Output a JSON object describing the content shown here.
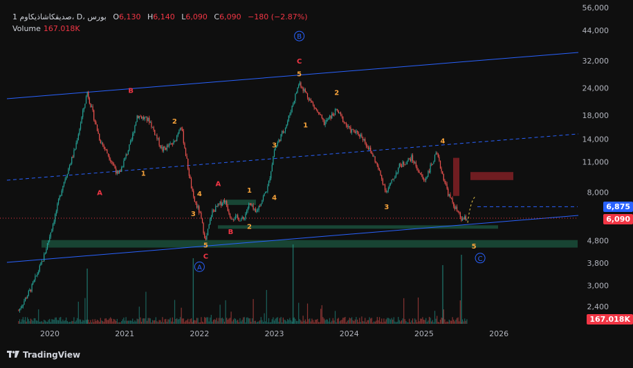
{
  "legend": {
    "symbol": "1 صديقكاشاذيكاوم، D، بورس",
    "open_label": "O",
    "open": "6,130",
    "high_label": "H",
    "high": "6,140",
    "low_label": "L",
    "low": "6,090",
    "close_label": "C",
    "close": "6,090",
    "change": "−180 (−2.87%)",
    "volume_label": "Volume",
    "volume": "167.018K"
  },
  "badges": {
    "line_price": "6,875",
    "last_price": "6,090",
    "volume": "167.018K"
  },
  "brand": "TradingView",
  "colors": {
    "background": "#0f0f0f",
    "up": "#26a69a",
    "down": "#ef5350",
    "trendline": "#2962ff",
    "wave_label": "#f7a33b",
    "abc_label": "#f23645",
    "zone_green": "#1a4d3a",
    "zone_red": "#7a1f24"
  },
  "chart_data": {
    "type": "candlestick",
    "y_scale": "log",
    "y_ticks": [
      "56,000",
      "44,000",
      "32,000",
      "24,000",
      "18,000",
      "14,000",
      "11,000",
      "8,000",
      "6,875",
      "6,090",
      "4,800",
      "3,800",
      "3,000",
      "2,400"
    ],
    "x_ticks": [
      "2020",
      "2021",
      "2022",
      "2023",
      "2024",
      "2025",
      "2026"
    ],
    "price_path": [
      [
        "2019-08",
        2300
      ],
      [
        "2019-10",
        2900
      ],
      [
        "2019-12",
        4000
      ],
      [
        "2020-02",
        6500
      ],
      [
        "2020-03",
        8500
      ],
      [
        "2020-05",
        12500
      ],
      [
        "2020-07",
        23000
      ],
      [
        "2020-09",
        14000
      ],
      [
        "2020-11",
        11000
      ],
      [
        "2020-12",
        9500
      ],
      [
        "2021-02",
        13500
      ],
      [
        "2021-03",
        18000
      ],
      [
        "2021-05",
        17000
      ],
      [
        "2021-07",
        12500
      ],
      [
        "2021-09",
        13500
      ],
      [
        "2021-10",
        16500
      ],
      [
        "2021-11",
        11000
      ],
      [
        "2021-12",
        7500
      ],
      [
        "2022-01",
        6500
      ],
      [
        "2022-02",
        4800
      ],
      [
        "2022-03",
        6500
      ],
      [
        "2022-05",
        7400
      ],
      [
        "2022-06",
        6200
      ],
      [
        "2022-08",
        6000
      ],
      [
        "2022-09",
        7100
      ],
      [
        "2022-10",
        6400
      ],
      [
        "2022-12",
        8500
      ],
      [
        "2023-01",
        12500
      ],
      [
        "2023-03",
        16500
      ],
      [
        "2023-05",
        25500
      ],
      [
        "2023-07",
        20500
      ],
      [
        "2023-09",
        16500
      ],
      [
        "2023-11",
        19000
      ],
      [
        "2024-01",
        15500
      ],
      [
        "2024-03",
        14500
      ],
      [
        "2024-05",
        11500
      ],
      [
        "2024-07",
        8000
      ],
      [
        "2024-09",
        10500
      ],
      [
        "2024-11",
        11500
      ],
      [
        "2025-01",
        9000
      ],
      [
        "2025-03",
        12000
      ],
      [
        "2025-05",
        7700
      ],
      [
        "2025-07",
        6000
      ],
      [
        "2025-08",
        6090
      ]
    ],
    "wave_labels": [
      {
        "text": "1",
        "date": "2021-04",
        "price": 9800,
        "style": "orange"
      },
      {
        "text": "2",
        "date": "2021-09",
        "price": 17000,
        "style": "orange"
      },
      {
        "text": "3",
        "date": "2021-12",
        "price": 6400,
        "style": "orange"
      },
      {
        "text": "4",
        "date": "2022-01",
        "price": 7900,
        "style": "orange"
      },
      {
        "text": "5",
        "date": "2022-02",
        "price": 4600,
        "style": "orange"
      },
      {
        "text": "C",
        "date": "2022-02",
        "price": 4100,
        "style": "red"
      },
      {
        "text": "A",
        "date": "2022-01",
        "price": 3650,
        "style": "circle"
      },
      {
        "text": "A",
        "date": "2020-09",
        "price": 8000,
        "style": "red"
      },
      {
        "text": "B",
        "date": "2021-02",
        "price": 23500,
        "style": "red"
      },
      {
        "text": "A",
        "date": "2022-04",
        "price": 8800,
        "style": "red"
      },
      {
        "text": "1",
        "date": "2022-09",
        "price": 8200,
        "style": "orange"
      },
      {
        "text": "B",
        "date": "2022-06",
        "price": 5300,
        "style": "red"
      },
      {
        "text": "2",
        "date": "2022-09",
        "price": 5600,
        "style": "orange"
      },
      {
        "text": "3",
        "date": "2023-01",
        "price": 13200,
        "style": "orange"
      },
      {
        "text": "4",
        "date": "2023-01",
        "price": 7600,
        "style": "orange"
      },
      {
        "text": "5",
        "date": "2023-05",
        "price": 28000,
        "style": "orange"
      },
      {
        "text": "C",
        "date": "2023-05",
        "price": 32000,
        "style": "red"
      },
      {
        "text": "B",
        "date": "2023-05",
        "price": 41500,
        "style": "circle"
      },
      {
        "text": "1",
        "date": "2023-06",
        "price": 16300,
        "style": "orange"
      },
      {
        "text": "2",
        "date": "2023-11",
        "price": 23000,
        "style": "orange"
      },
      {
        "text": "3",
        "date": "2024-07",
        "price": 6900,
        "style": "orange"
      },
      {
        "text": "4",
        "date": "2025-04",
        "price": 13800,
        "style": "orange"
      },
      {
        "text": "5",
        "date": "2025-09",
        "price": 4550,
        "style": "orange"
      },
      {
        "text": "C",
        "date": "2025-10",
        "price": 4000,
        "style": "circle"
      }
    ]
  }
}
